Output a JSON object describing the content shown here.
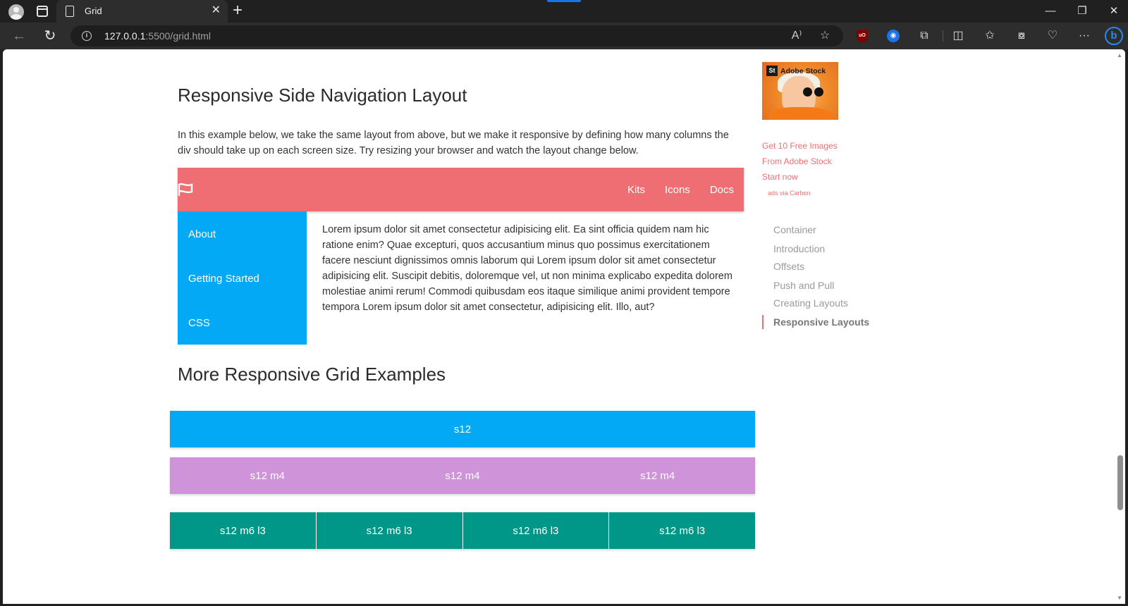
{
  "browser": {
    "tab_title": "Grid",
    "url_host": "127.0.0.1",
    "url_rest": ":5500/grid.html",
    "read_aloud_label": "A⁾",
    "ext_ublock": "uO"
  },
  "sections": {
    "responsive_title": "Responsive Side Navigation Layout",
    "intro": "In this example below, we take the same layout from above, but we make it responsive by defining how many columns the div should take up on each screen size. Try resizing your browser and watch the layout change below.",
    "more_title": "More Responsive Grid Examples"
  },
  "demo": {
    "nav_links": [
      "Kits",
      "Icons",
      "Docs"
    ],
    "side_links": [
      "About",
      "Getting Started",
      "CSS"
    ],
    "body": "Lorem ipsum dolor sit amet consectetur adipisicing elit. Ea sint officia quidem nam hic ratione enim? Quae excepturi, quos accusantium minus quo possimus exercitationem facere nesciunt dignissimos omnis laborum qui Lorem ipsum dolor sit amet consectetur adipisicing elit. Suscipit debitis, doloremque vel, ut non minima explicabo expedita dolorem molestiae animi rerum! Commodi quibusdam eos itaque similique animi provident tempore tempora Lorem ipsum dolor sit amet consectetur, adipisicing elit. Illo, aut?",
    "colors": {
      "nav": "#ee6e73",
      "side": "#03a9f4"
    }
  },
  "ad": {
    "badge": "St",
    "brand": "Adobe Stock",
    "line1": "Get 10 Free Images",
    "line2": "From Adobe Stock",
    "line3": "Start now",
    "via": "ads via Carbon"
  },
  "toc": {
    "items": [
      "Container",
      "Introduction",
      "Offsets",
      "Push and Pull",
      "Creating Layouts",
      "Responsive Layouts"
    ],
    "active": "Responsive Layouts"
  },
  "grid_examples": {
    "row1": [
      "s12"
    ],
    "row2": [
      "s12 m4",
      "s12 m4",
      "s12 m4"
    ],
    "row3": [
      "s12 m6 l3",
      "s12 m6 l3",
      "s12 m6 l3",
      "s12 m6 l3"
    ],
    "colors": {
      "row1": "#03a9f4",
      "row2": "#ce93d8",
      "row3": "#009688"
    }
  }
}
